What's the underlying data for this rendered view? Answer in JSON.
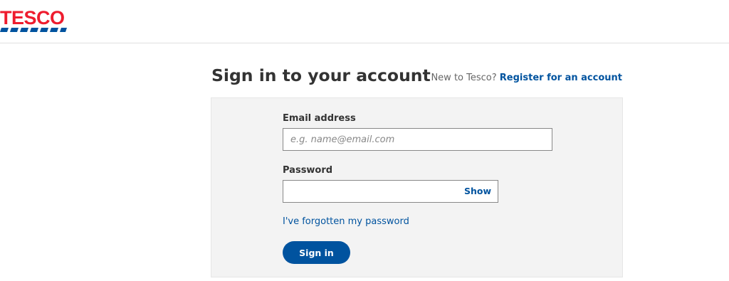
{
  "brand": {
    "name": "TESCO",
    "primary_color": "#ee1c2e",
    "accent_color": "#00539f"
  },
  "page": {
    "title": "Sign in to your account",
    "register_prompt": "New to Tesco?",
    "register_link": "Register for an account"
  },
  "form": {
    "email_label": "Email address",
    "email_placeholder": "e.g. name@email.com",
    "email_value": "",
    "password_label": "Password",
    "password_value": "",
    "show_label": "Show",
    "forgot_link": "I've forgotten my password",
    "signin_label": "Sign in"
  }
}
